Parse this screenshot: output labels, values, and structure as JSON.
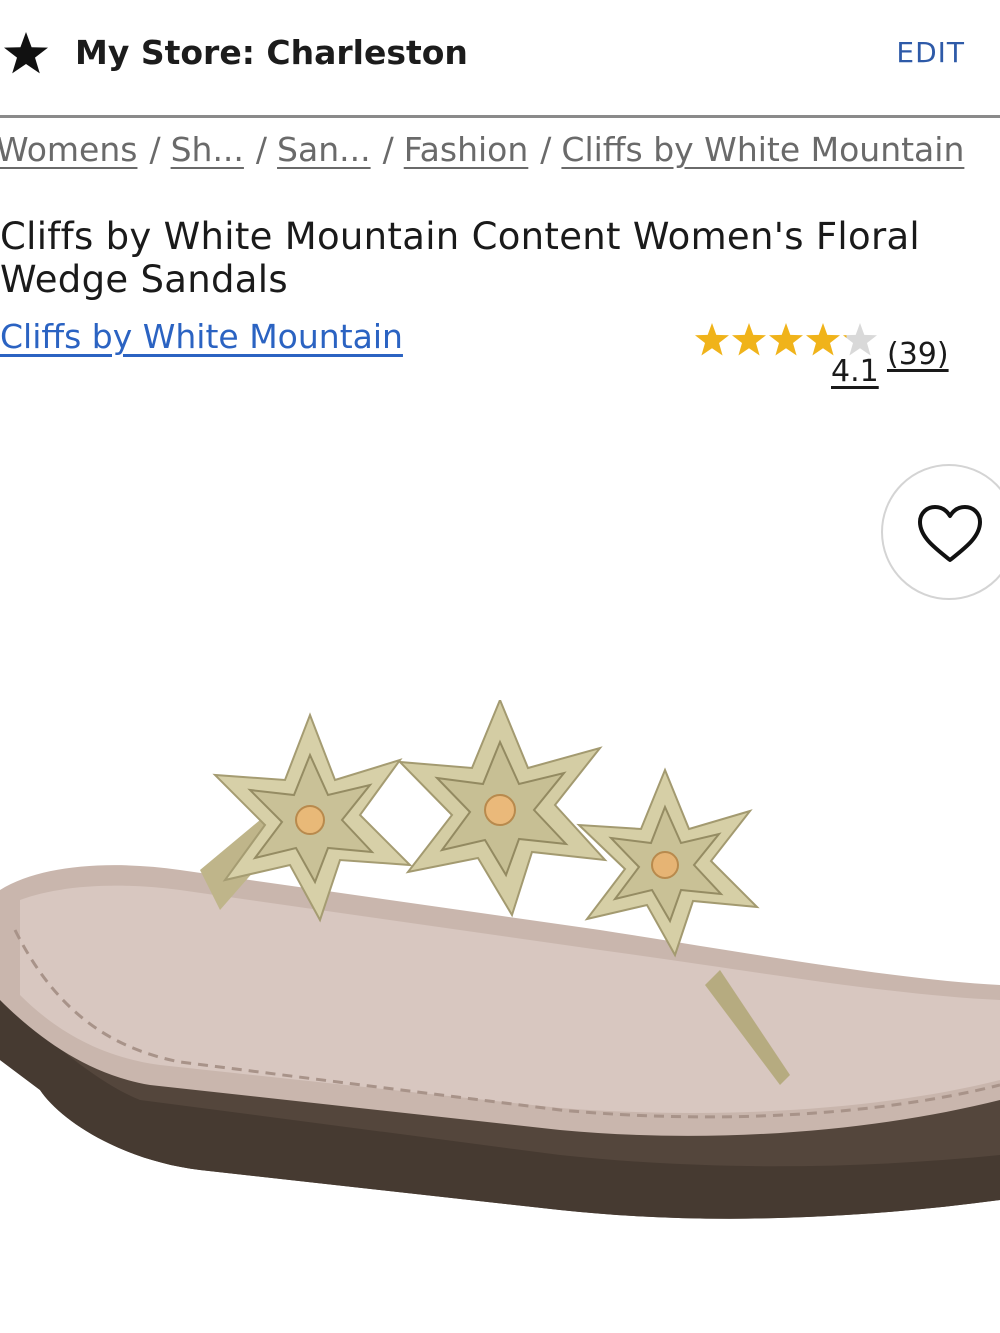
{
  "store": {
    "label": "My Store: Charleston",
    "edit_label": "EDIT",
    "icon": "star-icon"
  },
  "breadcrumb": [
    "Womens",
    "Sh...",
    "San...",
    "Fashion",
    "Cliffs by White Mountain"
  ],
  "breadcrumb_separator": "/",
  "product": {
    "title": "Cliffs by White Mountain Content Women's Floral Wedge Sandals",
    "brand": "Cliffs by White Mountain",
    "rating": "4.1",
    "review_count": "(39)",
    "rating_fraction": 0.82
  },
  "favorite": {
    "icon": "heart-icon"
  },
  "colors": {
    "link_blue": "#2b63c2",
    "edit_blue": "#2e5aa8",
    "star_gold": "#f0b31a",
    "star_empty": "#d9d9d9"
  }
}
